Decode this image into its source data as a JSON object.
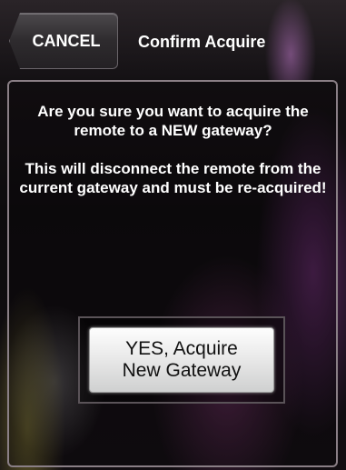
{
  "header": {
    "cancel_label": "CANCEL",
    "title": "Confirm Acquire"
  },
  "message": {
    "line1": "Are you sure you want to acquire the remote to a NEW gateway?",
    "line2": "This will disconnect the remote from the current gateway and must be re-acquired!"
  },
  "action": {
    "yes_label_line1": "YES, Acquire",
    "yes_label_line2": "New Gateway"
  },
  "colors": {
    "background": "#0d0b0d",
    "text": "#ffffff",
    "button_face": "#eaeaea"
  }
}
